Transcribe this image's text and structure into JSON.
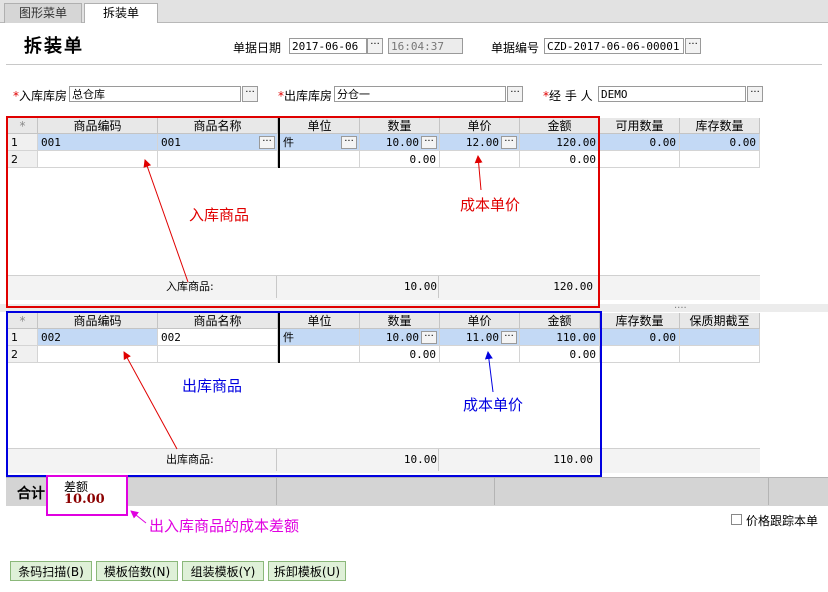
{
  "tabs": [
    {
      "label": "图形菜单"
    },
    {
      "label": "拆装单"
    }
  ],
  "title": "拆装单",
  "header": {
    "date_label": "单据日期",
    "date_value": "2017-06-06",
    "time_value": "16:04:37",
    "no_label": "单据编号",
    "no_value": "CZD-2017-06-06-00001",
    "in_wh_label": "入库库房",
    "in_wh_value": "总仓库",
    "out_wh_label": "出库库房",
    "out_wh_value": "分仓一",
    "handler_label": "经 手 人",
    "handler_value": "DEMO",
    "required_mark": "*",
    "dots": "···"
  },
  "in_grid": {
    "columns": [
      "*",
      "商品编码",
      "商品名称",
      "单位",
      "数量",
      "单价",
      "金额",
      "可用数量",
      "库存数量"
    ],
    "rows": [
      {
        "no": "1",
        "code": "001",
        "name": "001",
        "unit": "件",
        "qty": "10.00",
        "price": "12.00",
        "amount": "120.00",
        "avail": "0.00",
        "stock": "0.00"
      },
      {
        "no": "2",
        "code": "",
        "name": "",
        "unit": "",
        "qty": "0.00",
        "price": "",
        "amount": "0.00",
        "avail": "",
        "stock": ""
      }
    ],
    "summary": {
      "label": "入库商品:",
      "qty": "10.00",
      "amount": "120.00"
    }
  },
  "out_grid": {
    "columns": [
      "*",
      "商品编码",
      "商品名称",
      "单位",
      "数量",
      "单价",
      "金额",
      "库存数量",
      "保质期截至"
    ],
    "rows": [
      {
        "no": "1",
        "code": "002",
        "name": "002",
        "unit": "件",
        "qty": "10.00",
        "price": "11.00",
        "amount": "110.00",
        "stock": "0.00",
        "expiry": ""
      },
      {
        "no": "2",
        "code": "",
        "name": "",
        "unit": "",
        "qty": "0.00",
        "price": "",
        "amount": "0.00",
        "stock": "",
        "expiry": ""
      }
    ],
    "summary": {
      "label": "出库商品:",
      "qty": "10.00",
      "amount": "110.00"
    }
  },
  "splitter": "....",
  "total": {
    "label": "合计",
    "diff_label": "差额",
    "diff_value": "10.00"
  },
  "annotations": {
    "in_goods": "入库商品",
    "in_cost": "成本单价",
    "out_goods": "出库商品",
    "out_cost": "成本单价",
    "diff_note": "出入库商品的成本差额",
    "colors": {
      "red": "#e00000",
      "blue": "#0000e0",
      "magenta": "#e000e0"
    }
  },
  "price_track_label": "价格跟踪本单",
  "buttons": [
    {
      "label": "条码扫描(B)"
    },
    {
      "label": "模板倍数(N)"
    },
    {
      "label": "组装模板(Y)"
    },
    {
      "label": "拆卸模板(U)"
    }
  ]
}
